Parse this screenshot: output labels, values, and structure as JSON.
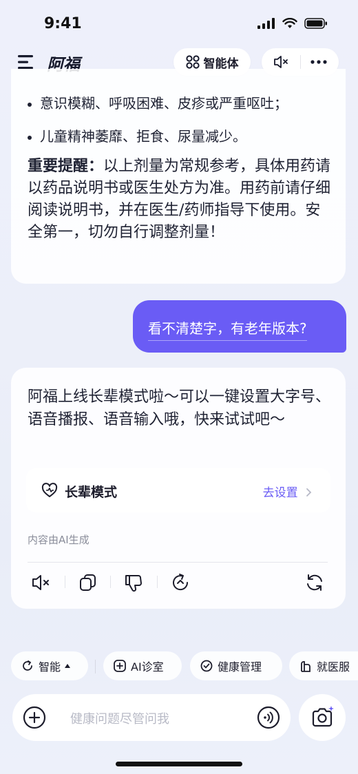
{
  "status_bar": {
    "time": "9:41"
  },
  "header": {
    "title": "阿福",
    "agent_label": "智能体"
  },
  "previous_message": {
    "bullets": [
      "意识模糊、呼吸困难、皮疹或严重呕吐；",
      "儿童精神萎靡、拒食、尿量减少。"
    ],
    "reminder_bold": "重要提醒：",
    "reminder_text": "以上剂量为常规参考，具体用药请以药品说明书或医生处方为准。用药前请仔细阅读说明书，并在医生/药师指导下使用。安全第一，切勿自行调整剂量！"
  },
  "user_message": "看不清楚字，有老年版本?",
  "reply": {
    "text": "阿福上线长辈模式啦～可以一键设置大字号、语音播报、语音输入哦，快来试试吧～",
    "elder_mode_label": "长辈模式",
    "elder_mode_link": "去设置",
    "ai_note": "内容由AI生成"
  },
  "chips": [
    "智能",
    "AI诊室",
    "健康管理",
    "就医服"
  ],
  "input": {
    "placeholder": "健康问题尽管问我"
  },
  "colors": {
    "accent": "#6a5cf5",
    "text": "#1f2233",
    "muted": "#8a8d9a"
  }
}
